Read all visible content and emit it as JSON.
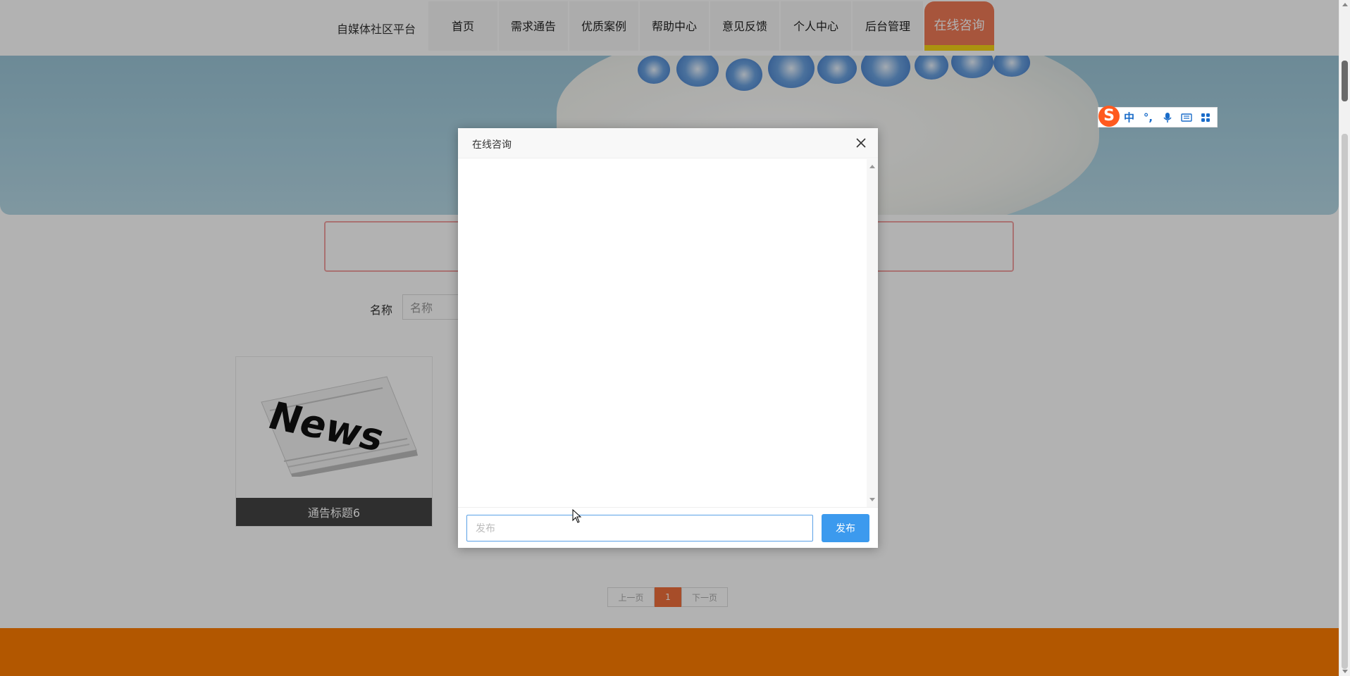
{
  "header": {
    "brand": "自媒体社区平台",
    "nav": [
      {
        "label": "首页"
      },
      {
        "label": "需求通告"
      },
      {
        "label": "优质案例"
      },
      {
        "label": "帮助中心"
      },
      {
        "label": "意见反馈"
      },
      {
        "label": "个人中心"
      },
      {
        "label": "后台管理"
      },
      {
        "label": "在线咨询",
        "active": true
      }
    ]
  },
  "filter": {
    "label": "名称",
    "placeholder": "名称"
  },
  "cards": [
    {
      "title": "通告标题6",
      "image_text": "News"
    }
  ],
  "pagination": {
    "prev": "上一页",
    "current": "1",
    "next": "下一页"
  },
  "modal": {
    "title": "在线咨询",
    "input_placeholder": "发布",
    "send_label": "发布"
  },
  "ime": {
    "logo": "S",
    "items": [
      "中",
      "°,",
      "mic-icon",
      "keyboard-icon",
      "grid-icon"
    ],
    "lang_label": "中",
    "punct_label": "°,"
  },
  "colors": {
    "accent": "#ef7a56",
    "nav_underline": "#f5d218",
    "footer": "#ff7d00",
    "primary_button": "#3c9aee",
    "pager_current": "#f06f3c"
  }
}
